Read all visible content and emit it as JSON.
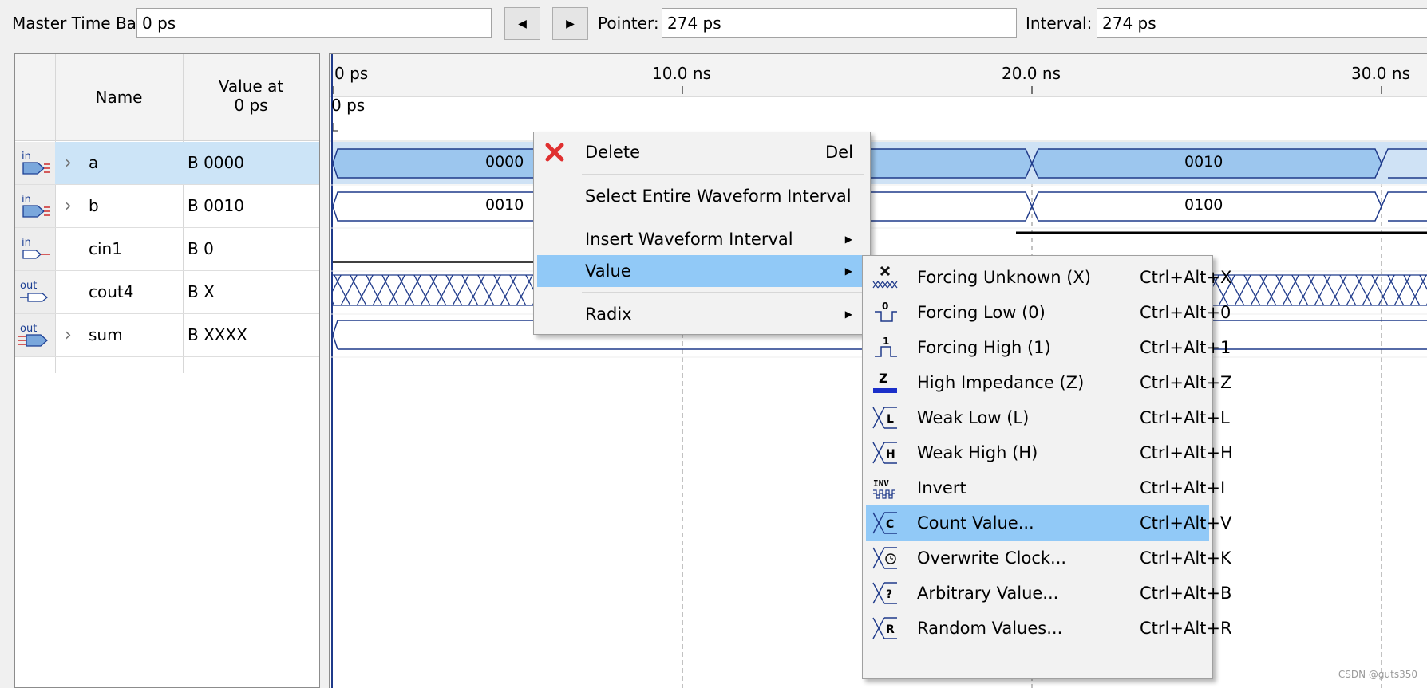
{
  "toolbar": {
    "master_time_bar_label": "Master Time Bar:",
    "master_time_bar_value": "0 ps",
    "pointer_label": "Pointer:",
    "pointer_value": "274 ps",
    "interval_label": "Interval:",
    "interval_value": "274 ps"
  },
  "table": {
    "header_name": "Name",
    "header_value_line1": "Value at",
    "header_value_line2": "0 ps",
    "signals": [
      {
        "dir": "in",
        "name": "a",
        "value": "B 0000",
        "expandable": true,
        "selected": true
      },
      {
        "dir": "in",
        "name": "b",
        "value": "B 0010",
        "expandable": true,
        "selected": false
      },
      {
        "dir": "in",
        "name": "cin1",
        "value": "B 0",
        "expandable": false,
        "selected": false
      },
      {
        "dir": "out",
        "name": "cout4",
        "value": "B X",
        "expandable": false,
        "selected": false
      },
      {
        "dir": "out",
        "name": "sum",
        "value": "B XXXX",
        "expandable": true,
        "selected": false
      }
    ]
  },
  "timeline": {
    "ticks": [
      "0 ps",
      "10.0 ns",
      "20.0 ns",
      "30.0 ns"
    ],
    "cursor_label": "0 ps"
  },
  "waves": {
    "a": [
      "0000",
      "0010"
    ],
    "b": [
      "0010",
      "0100"
    ]
  },
  "context_menu": {
    "items": [
      {
        "label": "Delete",
        "shortcut": "Del",
        "icon": "delete-x-icon"
      },
      {
        "label": "Select Entire Waveform Interval"
      },
      {
        "label": "Insert Waveform Interval",
        "submenu": true
      },
      {
        "label": "Value",
        "submenu": true,
        "highlighted": true
      },
      {
        "label": "Radix",
        "submenu": true
      }
    ]
  },
  "value_submenu": {
    "items": [
      {
        "label": "Forcing Unknown (X)",
        "shortcut": "Ctrl+Alt+X",
        "icon": "forcing-unknown-icon"
      },
      {
        "label": "Forcing Low (0)",
        "shortcut": "Ctrl+Alt+0",
        "icon": "forcing-low-icon"
      },
      {
        "label": "Forcing High (1)",
        "shortcut": "Ctrl+Alt+1",
        "icon": "forcing-high-icon"
      },
      {
        "label": "High Impedance (Z)",
        "shortcut": "Ctrl+Alt+Z",
        "icon": "high-impedance-icon"
      },
      {
        "label": "Weak Low (L)",
        "shortcut": "Ctrl+Alt+L",
        "icon": "weak-low-icon"
      },
      {
        "label": "Weak High (H)",
        "shortcut": "Ctrl+Alt+H",
        "icon": "weak-high-icon"
      },
      {
        "label": "Invert",
        "shortcut": "Ctrl+Alt+I",
        "icon": "invert-icon"
      },
      {
        "label": "Count Value...",
        "shortcut": "Ctrl+Alt+V",
        "icon": "count-value-icon",
        "highlighted": true
      },
      {
        "label": "Overwrite Clock...",
        "shortcut": "Ctrl+Alt+K",
        "icon": "overwrite-clock-icon"
      },
      {
        "label": "Arbitrary Value...",
        "shortcut": "Ctrl+Alt+B",
        "icon": "arbitrary-value-icon"
      },
      {
        "label": "Random Values...",
        "shortcut": "Ctrl+Alt+R",
        "icon": "random-values-icon"
      }
    ]
  },
  "watermark": "CSDN @guts350",
  "colors": {
    "wave_fill": "#9cc6ee",
    "wave_line": "#1f3a8a",
    "menu_highlight": "#91c9f7",
    "selection": "#cce4f7",
    "delete_red": "#e03030"
  }
}
